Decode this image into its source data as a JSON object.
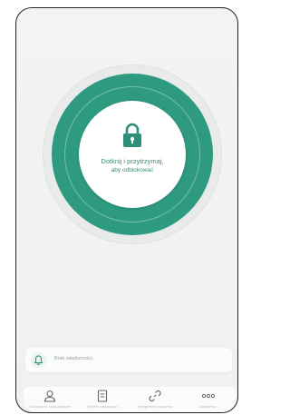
{
  "lock": {
    "line1": "Dotknij i przytrzymaj,",
    "line2": "aby odblokować",
    "icon": "padlock-icon",
    "ring_color": "#2e9a80"
  },
  "notifications": {
    "icon": "bell-icon",
    "text": "Brak wiadomości."
  },
  "nav": [
    {
      "icon": "person-icon",
      "label": "Zarządzanie użytkownikami"
    },
    {
      "icon": "document-icon",
      "label": "Rejestr odblokowań"
    },
    {
      "icon": "link-icon",
      "label": "Inteligentne połączenia"
    },
    {
      "icon": "more-icon",
      "label": "Ustawienia"
    }
  ]
}
